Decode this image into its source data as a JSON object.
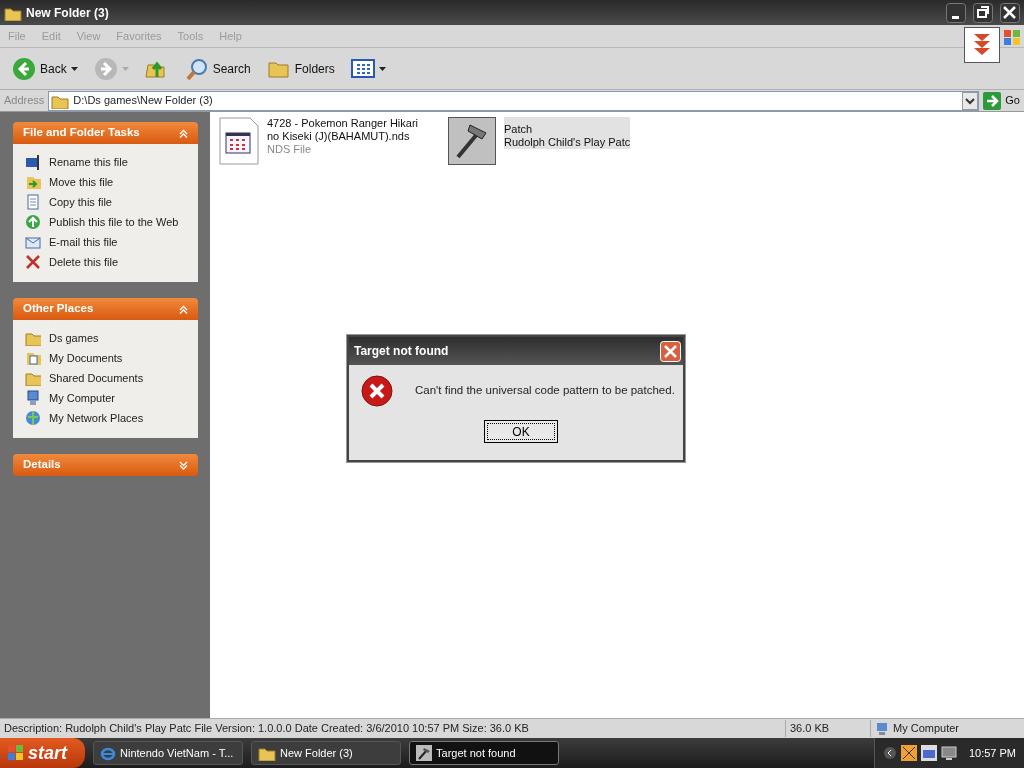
{
  "window": {
    "title": "New Folder (3)"
  },
  "menu": [
    "File",
    "Edit",
    "View",
    "Favorites",
    "Tools",
    "Help"
  ],
  "toolbar": [
    {
      "kind": "back",
      "label": "Back"
    },
    {
      "kind": "forward"
    },
    {
      "kind": "up"
    },
    {
      "kind": "search",
      "label": "Search"
    },
    {
      "kind": "folders",
      "label": "Folders"
    },
    {
      "kind": "views"
    }
  ],
  "address": {
    "label": "Address",
    "value": "D:\\Ds games\\New Folder (3)",
    "go": "Go"
  },
  "panels": [
    {
      "title": "File and Folder Tasks",
      "expanded": true,
      "items": [
        "Rename this file",
        "Move this file",
        "Copy this file",
        "Publish this file to the Web",
        "E-mail this file",
        "Delete this file"
      ]
    },
    {
      "title": "Other Places",
      "expanded": true,
      "items": [
        "Ds games",
        "My Documents",
        "Shared Documents",
        "My Computer",
        "My Network Places"
      ]
    },
    {
      "title": "Details",
      "expanded": false
    }
  ],
  "files": [
    {
      "kind": "nds",
      "name": "4728 - Pokemon Ranger Hikari no Kiseki (J)(BAHAMUT).nds",
      "type": "NDS File",
      "selected": false
    },
    {
      "kind": "exe",
      "name": "Patch",
      "type": "Rudolph Child's Play Patc",
      "selected": true
    }
  ],
  "dialog": {
    "title": "Target not found",
    "message": "Can't find the universal code pattern to be patched.",
    "button": "OK"
  },
  "status_bar": [
    "Description: Rudolph Child's Play Patc File Version: 1.0.0.0 Date Created: 3/6/2010 10:57 PM Size: 36.0 KB",
    "36.0 KB",
    "My Computer"
  ],
  "taskbar": {
    "start": "start",
    "tasks": [
      {
        "kind": "ie",
        "label": "Nintendo VietNam - T...",
        "selected": false
      },
      {
        "kind": "folder",
        "label": "New Folder (3)",
        "selected": false
      },
      {
        "kind": "app",
        "label": "Target not found",
        "selected": true
      }
    ],
    "clock": "10:57 PM"
  }
}
